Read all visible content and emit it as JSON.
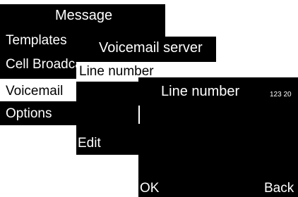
{
  "message_menu": {
    "title": "Message",
    "items": [
      "Templates",
      "Cell Broadcast",
      "Voicemail",
      "Options"
    ],
    "selected_index": 2
  },
  "voicemail_server": {
    "title": "Voicemail server",
    "items": [
      "Line number"
    ],
    "softkey": "Edit"
  },
  "line_number_editor": {
    "title": "Line number",
    "input_mode": "123 20",
    "value": "",
    "softkey_left": "OK",
    "softkey_right": "Back"
  }
}
